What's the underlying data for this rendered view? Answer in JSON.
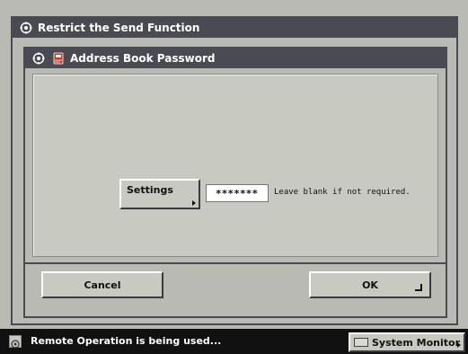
{
  "outer_window": {
    "title": "Restrict the Send Function",
    "icon": "gear-icon"
  },
  "inner_window": {
    "title": "Address Book Password",
    "icons": [
      "gear-icon",
      "address-book-icon"
    ]
  },
  "settings": {
    "label": "Settings",
    "password_value": "*******",
    "hint": "Leave blank if not required."
  },
  "buttons": {
    "cancel": "Cancel",
    "ok": "OK"
  },
  "status_bar": {
    "message": "Remote Operation is being used...",
    "system_monitor": "System Monitor"
  },
  "colors": {
    "title_bar": "#4a4b52",
    "panel": "#b9bab3",
    "status_bar": "#111111"
  }
}
